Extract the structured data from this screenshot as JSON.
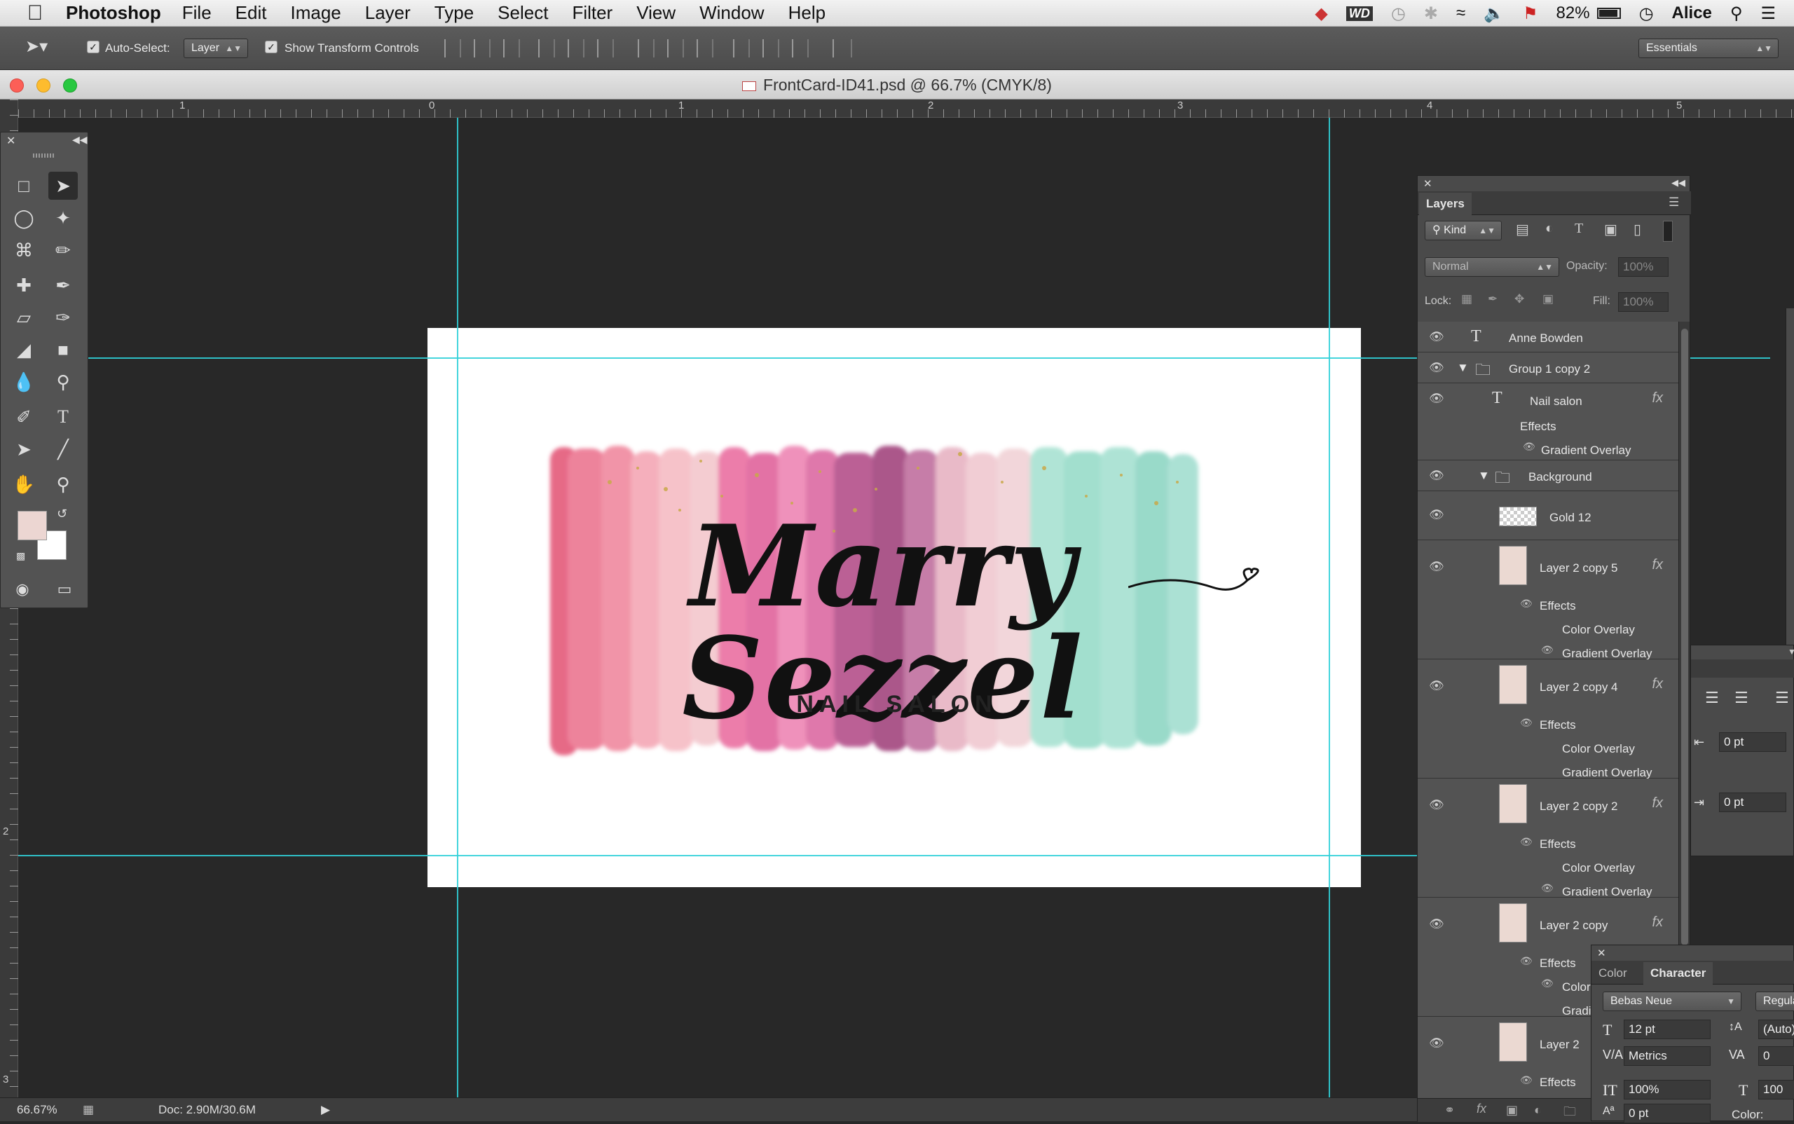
{
  "menubar": {
    "app_name": "Photoshop",
    "items": [
      "File",
      "Edit",
      "Image",
      "Layer",
      "Type",
      "Select",
      "Filter",
      "View",
      "Window",
      "Help"
    ],
    "battery": "82%",
    "user": "Alice"
  },
  "options": {
    "auto_select_label": "Auto-Select:",
    "auto_select_value": "Layer",
    "transform_label": "Show Transform Controls",
    "workspace": "Essentials"
  },
  "window": {
    "title": "FrontCard-ID41.psd @ 66.7% (CMYK/8)"
  },
  "ruler": {
    "h_ticks": [
      "1",
      "0",
      "1",
      "2",
      "3",
      "4",
      "5"
    ],
    "v_ticks": [
      "2",
      "3"
    ]
  },
  "artwork": {
    "script_text": "Marry Sezzel",
    "subtitle": "NAIL SALON"
  },
  "status": {
    "zoom": "66.67%",
    "doc": "Doc: 2.90M/30.6M"
  },
  "layers_panel": {
    "tab": "Layers",
    "filter_kind": "Kind",
    "blend_mode": "Normal",
    "opacity_label": "Opacity:",
    "opacity_value": "100%",
    "lock_label": "Lock:",
    "fill_label": "Fill:",
    "fill_value": "100%",
    "rows": {
      "r1": "Anne Bowden",
      "r2": "Group 1 copy 2",
      "r3": "Nail salon",
      "r3_effects": "Effects",
      "r3_grad": "Gradient Overlay",
      "r4": "Background",
      "r5": "Gold 12",
      "r6": "Layer 2 copy 5",
      "r6_effects": "Effects",
      "r6_color": "Color Overlay",
      "r6_grad": "Gradient Overlay",
      "r7": "Layer 2 copy 4",
      "r7_effects": "Effects",
      "r7_color": "Color Overlay",
      "r7_grad": "Gradient Overlay",
      "r8": "Layer 2 copy 2",
      "r8_effects": "Effects",
      "r8_color": "Color Overlay",
      "r8_grad": "Gradient Overlay",
      "r9": "Layer 2 copy",
      "r9_effects": "Effects",
      "r9_color": "Color",
      "r9_grad": "Gradi",
      "r10": "Layer 2",
      "r10_effects": "Effects"
    }
  },
  "paragraph_panel": {
    "indent1": "0 pt",
    "indent2": "0 pt"
  },
  "character_panel": {
    "tab_color": "Color",
    "tab_character": "Character",
    "font": "Bebas Neue",
    "style": "Regula",
    "size": "12 pt",
    "leading": "(Auto)",
    "kerning": "Metrics",
    "tracking": "0",
    "vscale": "100%",
    "hscale": "100",
    "baseline": "0 pt",
    "color_label": "Color:"
  }
}
